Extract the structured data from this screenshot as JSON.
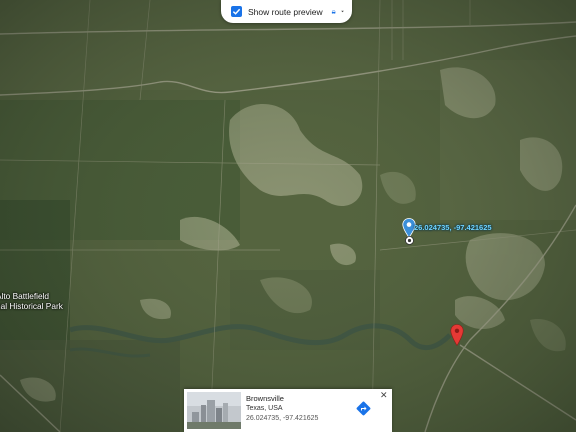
{
  "route_preview": {
    "label": "Show route preview",
    "checked": true
  },
  "map_labels": {
    "park": "Alto Battlefield\nnal Historical Park"
  },
  "pin": {
    "coordinates_label": "26.024735, -97.421625",
    "pin_color": "#3b8fd9"
  },
  "destination_pin": {
    "color": "#e53935"
  },
  "place_card": {
    "title": "Brownsville",
    "subtitle": "Texas, USA",
    "coordinates": "26.024735, -97.421625"
  },
  "colors": {
    "accent": "#1a73e8"
  }
}
